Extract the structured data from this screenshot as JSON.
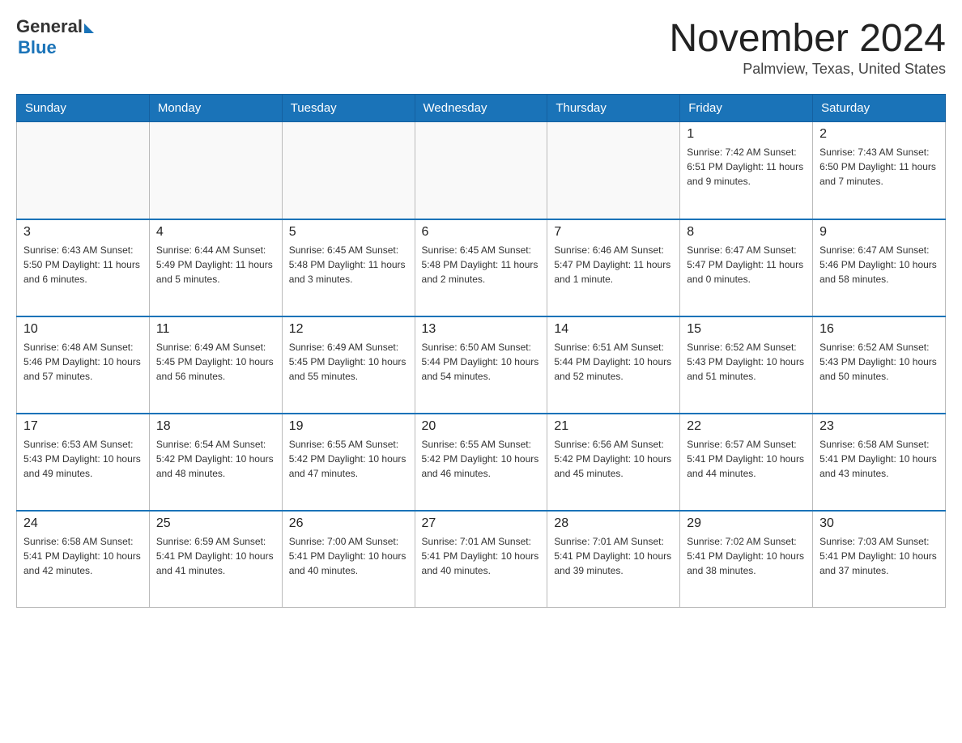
{
  "header": {
    "logo_general": "General",
    "logo_blue": "Blue",
    "month_title": "November 2024",
    "location": "Palmview, Texas, United States"
  },
  "days_of_week": [
    "Sunday",
    "Monday",
    "Tuesday",
    "Wednesday",
    "Thursday",
    "Friday",
    "Saturday"
  ],
  "weeks": [
    {
      "days": [
        {
          "date": "",
          "info": ""
        },
        {
          "date": "",
          "info": ""
        },
        {
          "date": "",
          "info": ""
        },
        {
          "date": "",
          "info": ""
        },
        {
          "date": "",
          "info": ""
        },
        {
          "date": "1",
          "info": "Sunrise: 7:42 AM\nSunset: 6:51 PM\nDaylight: 11 hours and 9 minutes."
        },
        {
          "date": "2",
          "info": "Sunrise: 7:43 AM\nSunset: 6:50 PM\nDaylight: 11 hours and 7 minutes."
        }
      ]
    },
    {
      "days": [
        {
          "date": "3",
          "info": "Sunrise: 6:43 AM\nSunset: 5:50 PM\nDaylight: 11 hours and 6 minutes."
        },
        {
          "date": "4",
          "info": "Sunrise: 6:44 AM\nSunset: 5:49 PM\nDaylight: 11 hours and 5 minutes."
        },
        {
          "date": "5",
          "info": "Sunrise: 6:45 AM\nSunset: 5:48 PM\nDaylight: 11 hours and 3 minutes."
        },
        {
          "date": "6",
          "info": "Sunrise: 6:45 AM\nSunset: 5:48 PM\nDaylight: 11 hours and 2 minutes."
        },
        {
          "date": "7",
          "info": "Sunrise: 6:46 AM\nSunset: 5:47 PM\nDaylight: 11 hours and 1 minute."
        },
        {
          "date": "8",
          "info": "Sunrise: 6:47 AM\nSunset: 5:47 PM\nDaylight: 11 hours and 0 minutes."
        },
        {
          "date": "9",
          "info": "Sunrise: 6:47 AM\nSunset: 5:46 PM\nDaylight: 10 hours and 58 minutes."
        }
      ]
    },
    {
      "days": [
        {
          "date": "10",
          "info": "Sunrise: 6:48 AM\nSunset: 5:46 PM\nDaylight: 10 hours and 57 minutes."
        },
        {
          "date": "11",
          "info": "Sunrise: 6:49 AM\nSunset: 5:45 PM\nDaylight: 10 hours and 56 minutes."
        },
        {
          "date": "12",
          "info": "Sunrise: 6:49 AM\nSunset: 5:45 PM\nDaylight: 10 hours and 55 minutes."
        },
        {
          "date": "13",
          "info": "Sunrise: 6:50 AM\nSunset: 5:44 PM\nDaylight: 10 hours and 54 minutes."
        },
        {
          "date": "14",
          "info": "Sunrise: 6:51 AM\nSunset: 5:44 PM\nDaylight: 10 hours and 52 minutes."
        },
        {
          "date": "15",
          "info": "Sunrise: 6:52 AM\nSunset: 5:43 PM\nDaylight: 10 hours and 51 minutes."
        },
        {
          "date": "16",
          "info": "Sunrise: 6:52 AM\nSunset: 5:43 PM\nDaylight: 10 hours and 50 minutes."
        }
      ]
    },
    {
      "days": [
        {
          "date": "17",
          "info": "Sunrise: 6:53 AM\nSunset: 5:43 PM\nDaylight: 10 hours and 49 minutes."
        },
        {
          "date": "18",
          "info": "Sunrise: 6:54 AM\nSunset: 5:42 PM\nDaylight: 10 hours and 48 minutes."
        },
        {
          "date": "19",
          "info": "Sunrise: 6:55 AM\nSunset: 5:42 PM\nDaylight: 10 hours and 47 minutes."
        },
        {
          "date": "20",
          "info": "Sunrise: 6:55 AM\nSunset: 5:42 PM\nDaylight: 10 hours and 46 minutes."
        },
        {
          "date": "21",
          "info": "Sunrise: 6:56 AM\nSunset: 5:42 PM\nDaylight: 10 hours and 45 minutes."
        },
        {
          "date": "22",
          "info": "Sunrise: 6:57 AM\nSunset: 5:41 PM\nDaylight: 10 hours and 44 minutes."
        },
        {
          "date": "23",
          "info": "Sunrise: 6:58 AM\nSunset: 5:41 PM\nDaylight: 10 hours and 43 minutes."
        }
      ]
    },
    {
      "days": [
        {
          "date": "24",
          "info": "Sunrise: 6:58 AM\nSunset: 5:41 PM\nDaylight: 10 hours and 42 minutes."
        },
        {
          "date": "25",
          "info": "Sunrise: 6:59 AM\nSunset: 5:41 PM\nDaylight: 10 hours and 41 minutes."
        },
        {
          "date": "26",
          "info": "Sunrise: 7:00 AM\nSunset: 5:41 PM\nDaylight: 10 hours and 40 minutes."
        },
        {
          "date": "27",
          "info": "Sunrise: 7:01 AM\nSunset: 5:41 PM\nDaylight: 10 hours and 40 minutes."
        },
        {
          "date": "28",
          "info": "Sunrise: 7:01 AM\nSunset: 5:41 PM\nDaylight: 10 hours and 39 minutes."
        },
        {
          "date": "29",
          "info": "Sunrise: 7:02 AM\nSunset: 5:41 PM\nDaylight: 10 hours and 38 minutes."
        },
        {
          "date": "30",
          "info": "Sunrise: 7:03 AM\nSunset: 5:41 PM\nDaylight: 10 hours and 37 minutes."
        }
      ]
    }
  ]
}
